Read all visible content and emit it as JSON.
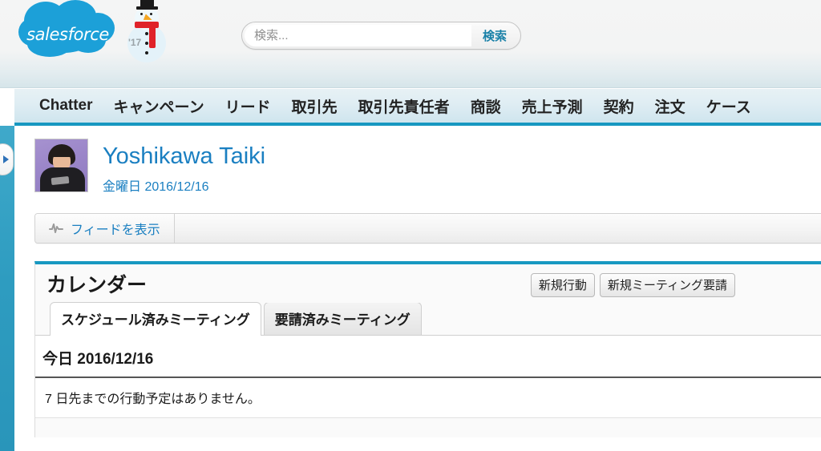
{
  "header": {
    "logo_text": "salesforce",
    "holiday_icon": "snowman-icon",
    "holiday_year": "'17",
    "search": {
      "placeholder": "検索...",
      "value": "",
      "button_label": "検索"
    }
  },
  "nav": {
    "tabs": [
      {
        "label": "Chatter"
      },
      {
        "label": "キャンペーン"
      },
      {
        "label": "リード"
      },
      {
        "label": "取引先"
      },
      {
        "label": "取引先責任者"
      },
      {
        "label": "商談"
      },
      {
        "label": "売上予測"
      },
      {
        "label": "契約"
      },
      {
        "label": "注文"
      },
      {
        "label": "ケース"
      }
    ]
  },
  "sidebar": {
    "toggle_icon": "chevron-right-icon"
  },
  "profile": {
    "name": "Yoshikawa Taiki",
    "date": "金曜日 2016/12/16",
    "avatar_alt": "avatar"
  },
  "feedbar": {
    "icon": "feed-pulse-icon",
    "label": "フィードを表示"
  },
  "calendar": {
    "title": "カレンダー",
    "actions": [
      {
        "label": "新規行動"
      },
      {
        "label": "新規ミーティング要請"
      }
    ],
    "tabs": [
      {
        "label": "スケジュール済みミーティング",
        "active": true
      },
      {
        "label": "要請済みミーティング",
        "active": false
      }
    ],
    "today_heading": "今日 2016/12/16",
    "empty_message": "7 日先までの行動予定はありません。"
  },
  "colors": {
    "brand_blue": "#1798c1",
    "link_blue": "#1a7fc1",
    "rail_blue": "#2e9cc0",
    "logo_cloud": "#1ca0d8"
  }
}
